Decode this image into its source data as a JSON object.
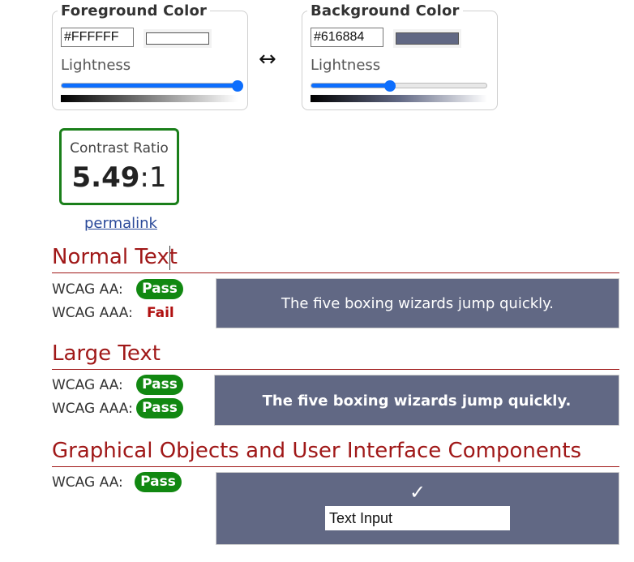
{
  "foreground": {
    "legend": "Foreground Color",
    "hex_value": "#FFFFFF",
    "swatch_color": "#FFFFFF",
    "lightness_label": "Lightness",
    "lightness_percent": 100
  },
  "swap_icon": "↔",
  "background": {
    "legend": "Background Color",
    "hex_value": "#616884",
    "swatch_color": "#616884",
    "lightness_label": "Lightness",
    "lightness_percent": 45
  },
  "contrast": {
    "label": "Contrast Ratio",
    "value_bold": "5.49",
    "value_rest": ":1",
    "border_color": "#1a7f1a"
  },
  "permalink": "permalink",
  "normal_text": {
    "title": "Normal Text",
    "aa_label": "WCAG AA:",
    "aa_result": "Pass",
    "aaa_label": "WCAG AAA:",
    "aaa_result": "Fail",
    "sample": "The five boxing wizards jump quickly."
  },
  "large_text": {
    "title": "Large Text",
    "aa_label": "WCAG AA:",
    "aa_result": "Pass",
    "aaa_label": "WCAG AAA:",
    "aaa_result": "Pass",
    "sample": "The five boxing wizards jump quickly."
  },
  "graphical": {
    "title": "Graphical Objects and User Interface Components",
    "aa_label": "WCAG AA:",
    "aa_result": "Pass",
    "check_icon": "✓",
    "text_input_value": "Text Input"
  },
  "colors": {
    "accent_red": "#a01818",
    "pass_green": "#118811",
    "slider_blue": "#0d6efd"
  }
}
